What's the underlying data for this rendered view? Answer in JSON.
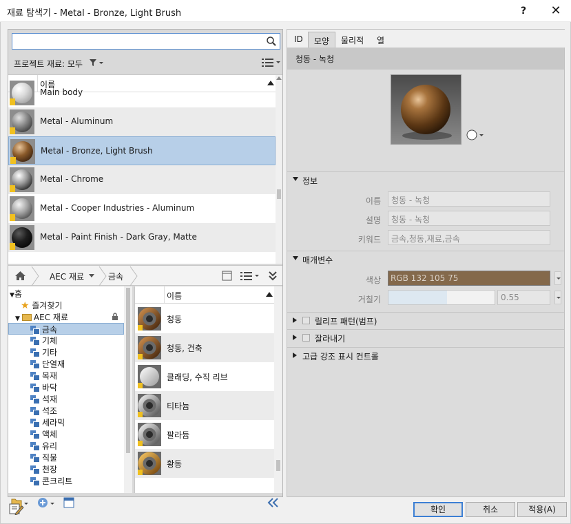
{
  "window": {
    "title": "재료 탐색기 - Metal - Bronze, Light Brush",
    "help": "?",
    "close": "✕"
  },
  "search": {
    "value": "",
    "placeholder": ""
  },
  "project": {
    "label": "프로젝트 재료: 모두"
  },
  "material_list": {
    "header": "이름",
    "items": [
      {
        "name": "Main body",
        "thumb": "white"
      },
      {
        "name": "Metal - Aluminum",
        "thumb": "gray"
      },
      {
        "name": "Metal - Bronze, Light Brush",
        "thumb": "bronze"
      },
      {
        "name": "Metal - Chrome",
        "thumb": "chrome"
      },
      {
        "name": "Metal - Cooper Industries - Aluminum",
        "thumb": "silver"
      },
      {
        "name": "Metal - Paint Finish - Dark Gray, Matte",
        "thumb": "dark"
      }
    ],
    "selected_index": 2
  },
  "library_bar": {
    "crumbs": [
      "AEC 재료",
      "금속"
    ]
  },
  "tree": {
    "root": "홈",
    "favorites": "즐겨찾기",
    "library": "AEC 재료",
    "items": [
      "금속",
      "기체",
      "기타",
      "단열재",
      "목재",
      "바닥",
      "석재",
      "석조",
      "세라믹",
      "액체",
      "유리",
      "직물",
      "천장",
      "콘크리트"
    ],
    "selected": "금속"
  },
  "library_list": {
    "header": "이름",
    "items": [
      {
        "name": "청동",
        "thumb": "ring-bronze"
      },
      {
        "name": "청동, 건축",
        "thumb": "ring-bronze"
      },
      {
        "name": "클래딩, 수직 리브",
        "thumb": "sphere-white"
      },
      {
        "name": "티타늄",
        "thumb": "ring-silver"
      },
      {
        "name": "팔라듐",
        "thumb": "ring-silver"
      },
      {
        "name": "황동",
        "thumb": "ring-gold"
      }
    ]
  },
  "tabs": [
    "ID",
    "모양",
    "물리적",
    "열"
  ],
  "active_tab": "모양",
  "appearance": {
    "asset_name": "청동 - 녹청",
    "info_section": "정보",
    "name_label": "이름",
    "name_value": "청동 - 녹청",
    "desc_label": "설명",
    "desc_value": "청동 - 녹청",
    "keyword_label": "키워드",
    "keyword_value": "금속,청동,재료,금속",
    "params_section": "매개변수",
    "color_label": "색상",
    "color_value": "RGB 132 105 75",
    "color_hex": "#84694b",
    "roughness_label": "거칠기",
    "roughness_value": "0.55",
    "roughness_fraction": 0.55,
    "relief_section": "릴리프 패턴(범프)",
    "cutout_section": "잘라내기",
    "advanced_section": "고급 강조 표시 컨트롤"
  },
  "buttons": {
    "ok": "확인",
    "cancel": "취소",
    "apply": "적용(A)"
  },
  "colors": {
    "selection": "#b7cfe8",
    "accent": "#3c7fd4"
  }
}
